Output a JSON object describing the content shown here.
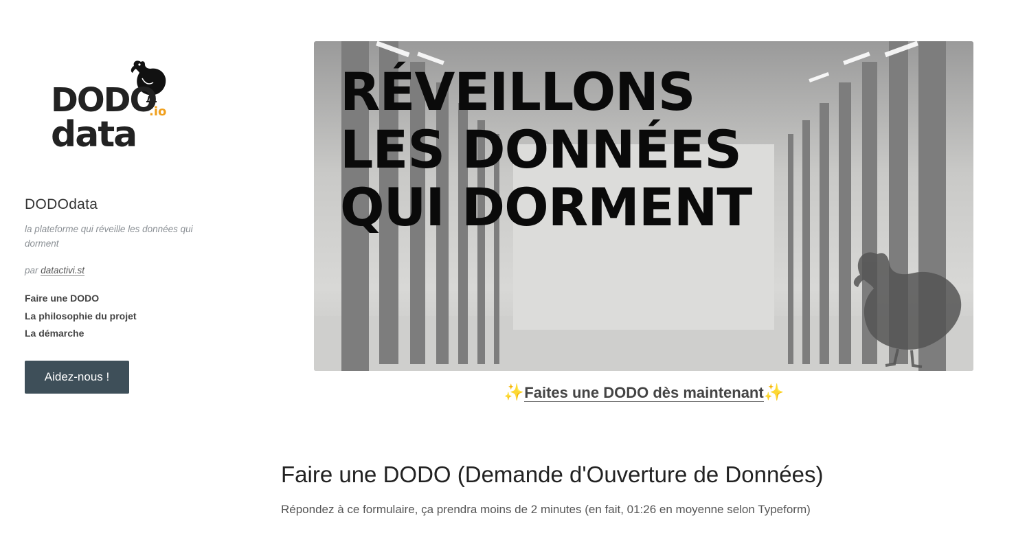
{
  "logo": {
    "line1": "DODO",
    "suffix": ".io",
    "line2": "data"
  },
  "sidebar": {
    "title": "DODOdata",
    "tagline": "la plateforme qui réveille les données qui dorment",
    "byline_prefix": "par ",
    "byline_link": "datactivi.st",
    "nav": [
      {
        "label": "Faire une DODO"
      },
      {
        "label": "La philosophie du projet"
      },
      {
        "label": "La démarche"
      }
    ],
    "help_button": "Aidez-nous !"
  },
  "hero": {
    "lines": [
      "RÉVEILLONS",
      "LES DONNÉES",
      "QUI DORMENT"
    ]
  },
  "cta": {
    "sparkle": "✨",
    "label": "Faites une DODO dès maintenant"
  },
  "section": {
    "title": "Faire une DODO (Demande d'Ouverture de Données)",
    "intro": "Répondez à ce formulaire, ça prendra moins de 2 minutes (en fait, 01:26 en moyenne selon Typeform)"
  }
}
